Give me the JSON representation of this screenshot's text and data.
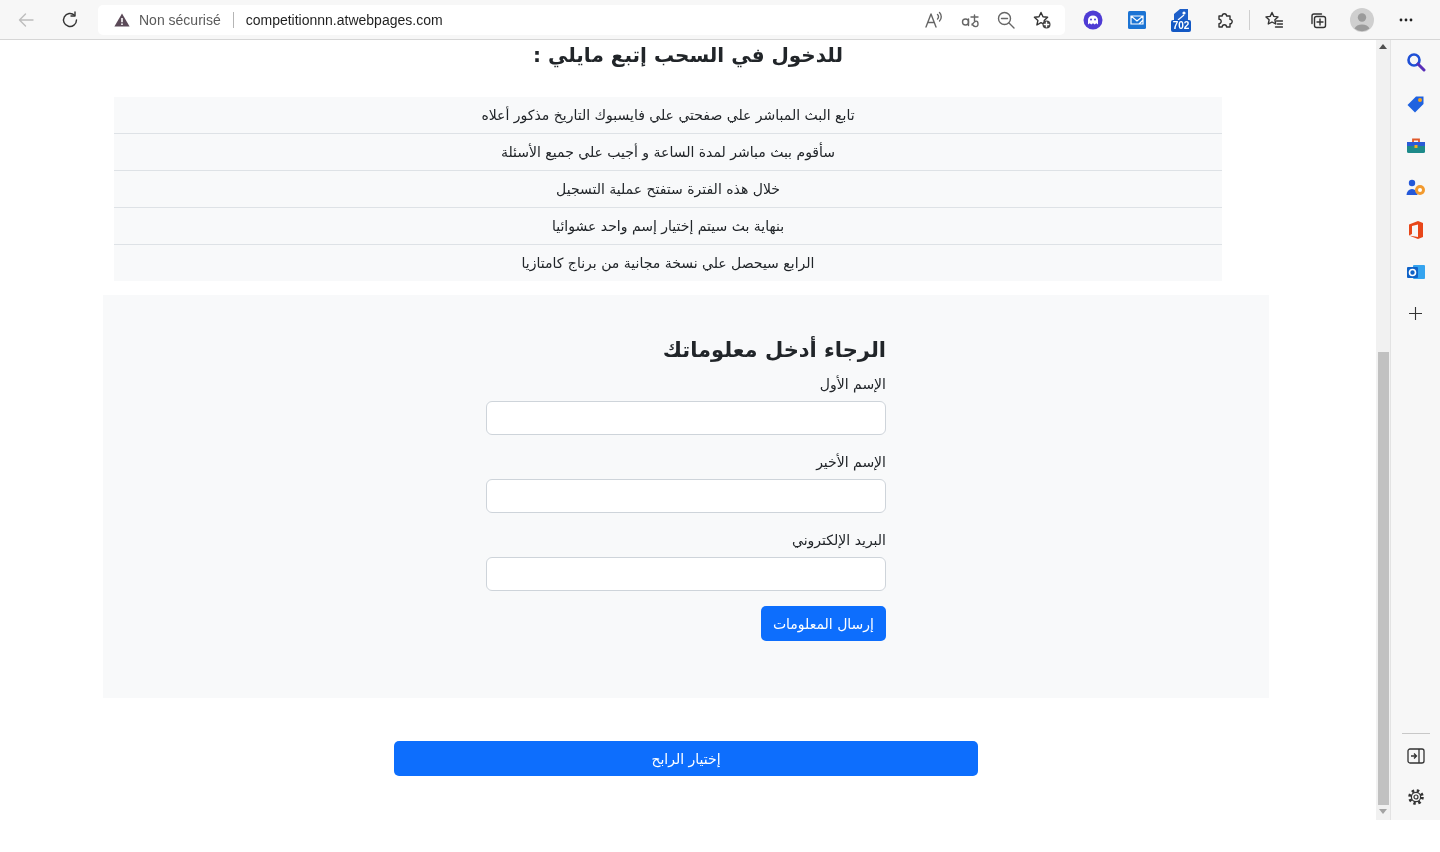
{
  "browser": {
    "back_button": {
      "disabled": true
    },
    "security_label": "Non sécurisé",
    "url": "competitionnn.atwebpages.com",
    "extension_badge": "702"
  },
  "page": {
    "heading": "للدخول في السحب إتبع مايلي :",
    "steps": [
      "تابع البث المباشر علي صفحتي علي فايسبوك التاريخ مذكور أعلاه",
      "سأقوم ببث مباشر لمدة الساعة و أجيب علي جميع الأسئلة",
      "خلال هذه الفترة ستفتح عملية التسجيل",
      "بنهاية بث سيتم إختيار إسم واحد عشوائيا",
      "الرابع سيحصل علي نسخة مجانية من برناج كامتازيا"
    ]
  },
  "form": {
    "title": "الرجاء أدخل معلوماتك",
    "fields": [
      {
        "label": "الإسم الأول"
      },
      {
        "label": "الإسم الأخير"
      },
      {
        "label": "البريد الإلكتروني"
      }
    ],
    "submit_label": "إرسال المعلومات"
  },
  "winner_button": {
    "label": "إختيار الرابح"
  }
}
